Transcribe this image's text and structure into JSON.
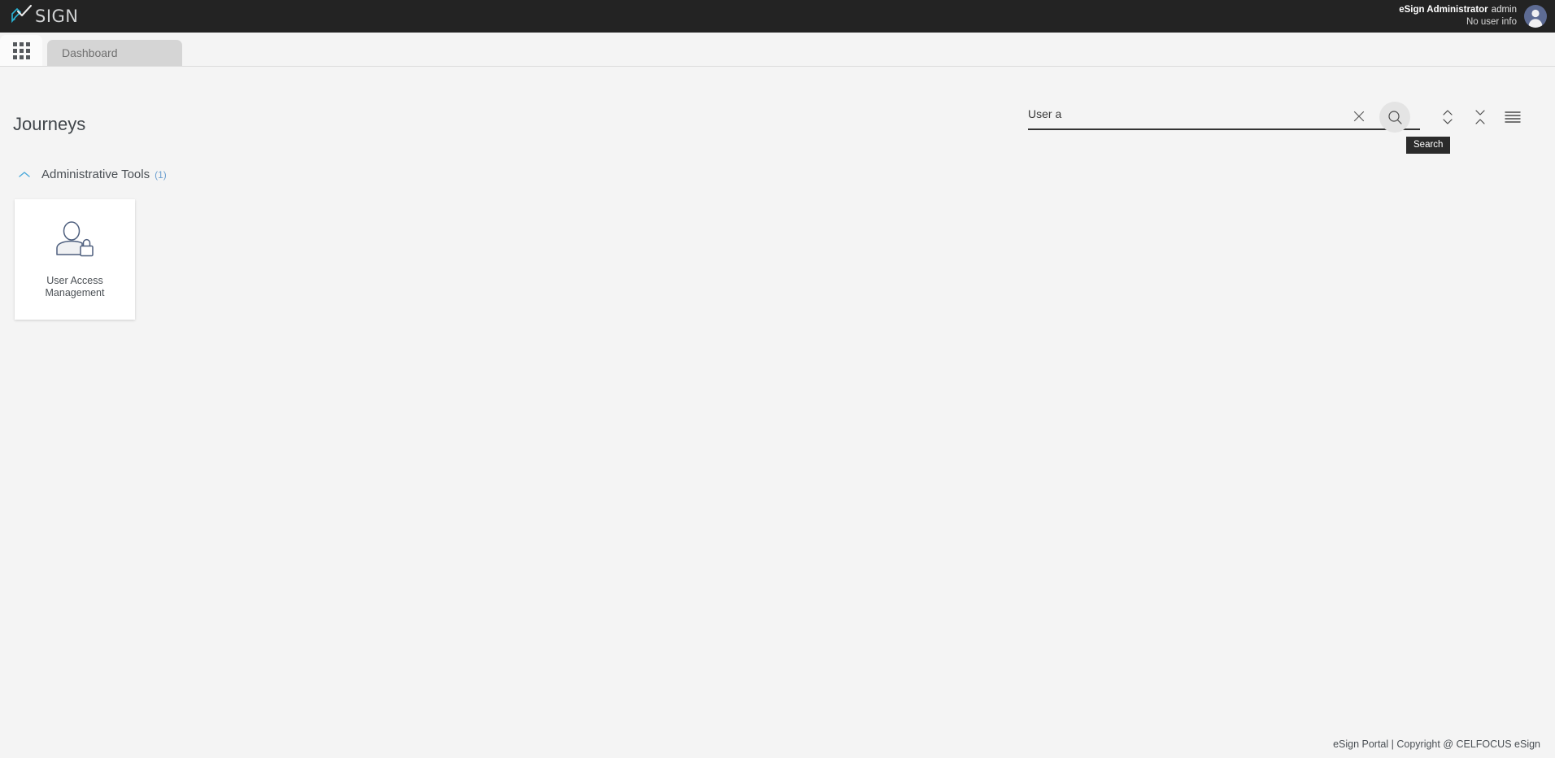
{
  "app": {
    "logo_text": "SIGN",
    "logo_icon": "pen-check-logo-icon",
    "brand_accent": "#29b6d8"
  },
  "header": {
    "user_name": "eSign Administrator",
    "user_login": "admin",
    "user_info": "No user info",
    "avatar_icon": "user-avatar-icon"
  },
  "tabbar": {
    "apps_icon": "apps-grid-icon",
    "tabs": [
      {
        "label": "Dashboard",
        "active": true
      }
    ]
  },
  "main": {
    "page_title": "Journeys",
    "search": {
      "value": "User a",
      "placeholder": "",
      "clear_icon": "close-icon",
      "search_icon": "search-icon",
      "tooltip": "Search"
    },
    "tools": [
      {
        "name": "expand-all-button",
        "icon": "expand-chevrons-icon"
      },
      {
        "name": "collapse-all-button",
        "icon": "collapse-chevrons-icon"
      },
      {
        "name": "menu-button",
        "icon": "hamburger-menu-icon"
      }
    ],
    "sections": [
      {
        "title": "Administrative Tools",
        "count": "(1)",
        "expanded": true,
        "chevron_icon": "chevron-up-icon",
        "chevron_color": "#4aa8da",
        "cards": [
          {
            "label": "User Access Management",
            "icon": "user-lock-icon"
          }
        ]
      }
    ]
  },
  "footer": {
    "text": "eSign Portal | Copyright @ CELFOCUS eSign"
  },
  "colors": {
    "header_bg": "#232323",
    "page_bg": "#f4f4f4",
    "tab_bg": "#d5d5d5",
    "card_bg": "#ffffff",
    "accent_blue": "#4aa8da"
  }
}
